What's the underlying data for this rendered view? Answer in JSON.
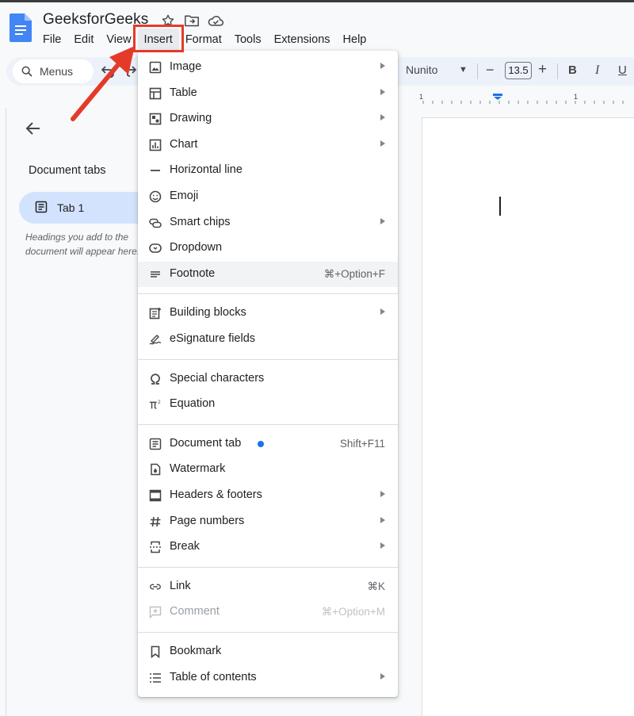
{
  "app": {
    "title": "GeeksforGeeks",
    "icons": [
      "docs-logo-icon",
      "star-icon",
      "move-folder-icon",
      "cloud-status-icon"
    ]
  },
  "menubar": {
    "items": [
      "File",
      "Edit",
      "View",
      "Insert",
      "Format",
      "Tools",
      "Extensions",
      "Help"
    ],
    "active": "Insert"
  },
  "toolbar": {
    "search_label": "Menus",
    "font": "Nunito",
    "font_size": "13.5",
    "minus": "−",
    "plus": "+",
    "bold": "B",
    "italic": "I",
    "underline": "U"
  },
  "ruler": {
    "num_left": "1",
    "num_right": "1"
  },
  "side_panel": {
    "title": "Document tabs",
    "tab_label": "Tab 1",
    "hint": "Headings you add to the document will appear here."
  },
  "insert_menu": {
    "sections": [
      [
        {
          "label": "Image",
          "icon": "image-icon",
          "submenu": true
        },
        {
          "label": "Table",
          "icon": "table-icon",
          "submenu": true
        },
        {
          "label": "Drawing",
          "icon": "drawing-icon",
          "submenu": true
        },
        {
          "label": "Chart",
          "icon": "chart-icon",
          "submenu": true
        },
        {
          "label": "Horizontal line",
          "icon": "horizontal-line-icon",
          "submenu": false
        },
        {
          "label": "Emoji",
          "icon": "emoji-icon",
          "submenu": false
        },
        {
          "label": "Smart chips",
          "icon": "smart-chips-icon",
          "submenu": true
        },
        {
          "label": "Dropdown",
          "icon": "dropdown-icon",
          "submenu": false
        },
        {
          "label": "Footnote",
          "icon": "footnote-icon",
          "shortcut": "⌘+Option+F",
          "hover": true
        }
      ],
      [
        {
          "label": "Building blocks",
          "icon": "building-blocks-icon",
          "submenu": true
        },
        {
          "label": "eSignature fields",
          "icon": "esignature-icon",
          "submenu": false
        }
      ],
      [
        {
          "label": "Special characters",
          "icon": "omega-icon",
          "submenu": false
        },
        {
          "label": "Equation",
          "icon": "pi-icon",
          "submenu": false
        }
      ],
      [
        {
          "label": "Document tab",
          "icon": "document-tab-icon",
          "shortcut": "Shift+F11",
          "new_dot": true
        },
        {
          "label": "Watermark",
          "icon": "watermark-icon",
          "submenu": false
        },
        {
          "label": "Headers & footers",
          "icon": "headers-footers-icon",
          "submenu": true
        },
        {
          "label": "Page numbers",
          "icon": "hash-icon",
          "submenu": true
        },
        {
          "label": "Break",
          "icon": "break-icon",
          "submenu": true
        }
      ],
      [
        {
          "label": "Link",
          "icon": "link-icon",
          "shortcut": "⌘K"
        },
        {
          "label": "Comment",
          "icon": "comment-icon",
          "shortcut": "⌘+Option+M",
          "disabled": true
        }
      ],
      [
        {
          "label": "Bookmark",
          "icon": "bookmark-icon",
          "submenu": false
        },
        {
          "label": "Table of contents",
          "icon": "table-of-contents-icon",
          "submenu": true
        }
      ]
    ]
  },
  "colors": {
    "highlight_box": "#e53a29",
    "accent_blue": "#1a73e8",
    "docs_blue": "#4285f4",
    "tab_pill": "#d3e3fd",
    "toolbar_bg": "#edf2fa"
  }
}
